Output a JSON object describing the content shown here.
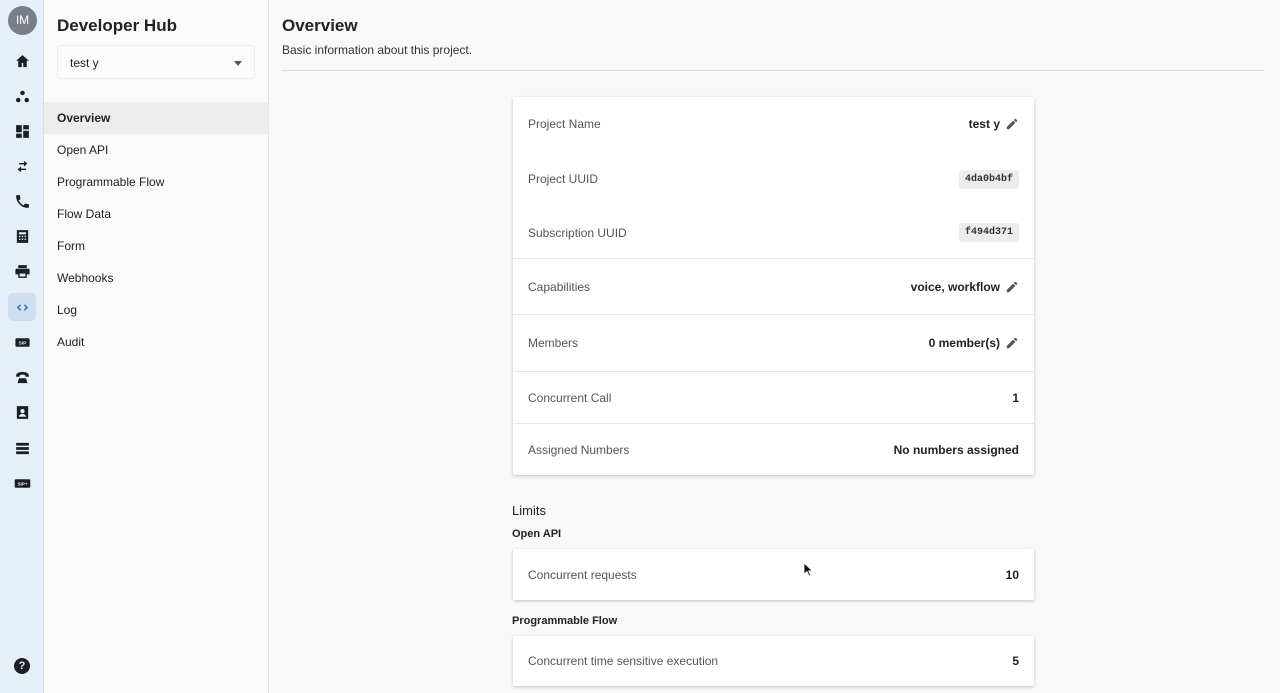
{
  "rail": {
    "avatar_initials": "IM",
    "icons": [
      "home-icon",
      "hub-icon",
      "dashboard-icon",
      "transfer-icon",
      "phone-icon",
      "billing-icon",
      "printer-icon",
      "code-icon",
      "sip-icon",
      "telephone-icon",
      "contacts-icon",
      "storage-icon",
      "sip-plus-icon",
      "help-icon"
    ],
    "active_icon": "code-icon",
    "sip_label": "SIP",
    "sip_plus_label": "SIP+",
    "help_label": "?"
  },
  "sidebar": {
    "title": "Developer Hub",
    "project_select_value": "test y",
    "nav": [
      {
        "label": "Overview",
        "active": true
      },
      {
        "label": "Open API"
      },
      {
        "label": "Programmable Flow"
      },
      {
        "label": "Flow Data"
      },
      {
        "label": "Form"
      },
      {
        "label": "Webhooks"
      },
      {
        "label": "Log"
      },
      {
        "label": "Audit"
      }
    ]
  },
  "main": {
    "title": "Overview",
    "subtitle": "Basic information about this project.",
    "info": {
      "project_name_label": "Project Name",
      "project_name_value": "test y",
      "project_uuid_label": "Project UUID",
      "project_uuid_value": "4da0b4bf",
      "subscription_uuid_label": "Subscription UUID",
      "subscription_uuid_value": "f494d371",
      "capabilities_label": "Capabilities",
      "capabilities_value": "voice, workflow",
      "members_label": "Members",
      "members_value": "0 member(s)",
      "concurrent_call_label": "Concurrent Call",
      "concurrent_call_value": "1",
      "assigned_numbers_label": "Assigned Numbers",
      "assigned_numbers_value": "No numbers assigned"
    },
    "limits": {
      "title": "Limits",
      "open_api": {
        "title": "Open API",
        "concurrent_requests_label": "Concurrent requests",
        "concurrent_requests_value": "10"
      },
      "programmable_flow": {
        "title": "Programmable Flow",
        "concurrent_execution_label": "Concurrent time sensitive execution",
        "concurrent_execution_value": "5"
      }
    }
  },
  "colors": {
    "rail_bg": "#e6eef8",
    "active_accent": "#2f6bc0",
    "page_bg": "#f8f8f8"
  }
}
